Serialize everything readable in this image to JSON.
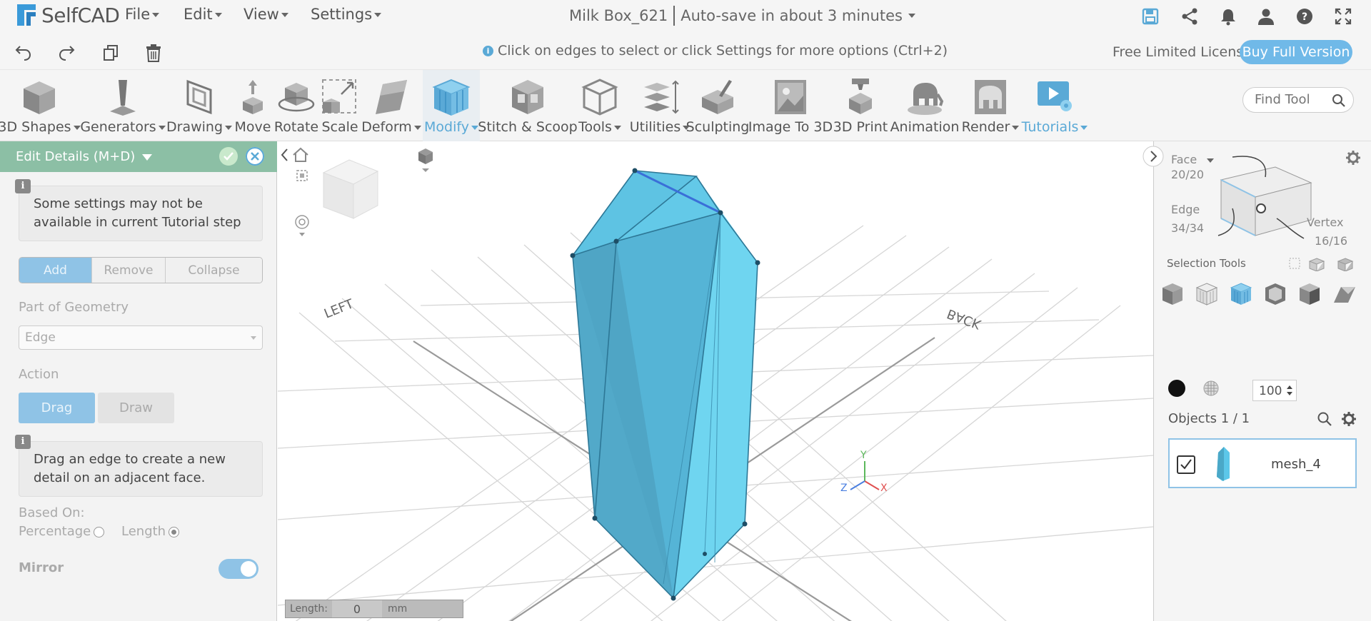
{
  "app": {
    "name": "SelfCAD"
  },
  "menu": {
    "file": "File",
    "edit": "Edit",
    "view": "View",
    "settings": "Settings"
  },
  "header": {
    "project_name": "Milk Box_621",
    "autosave": "Auto-save in about 3 minutes"
  },
  "secondary": {
    "hint": "Click on edges to select or click Settings for more options (Ctrl+2)",
    "license": "Free Limited License",
    "buy_label": "Buy Full Version"
  },
  "toolbar": {
    "tools": [
      {
        "label": "3D Shapes",
        "dropdown": true
      },
      {
        "label": "Generators",
        "dropdown": true
      },
      {
        "label": "Drawing",
        "dropdown": true
      },
      {
        "label": "Move"
      },
      {
        "label": "Rotate"
      },
      {
        "label": "Scale"
      },
      {
        "label": "Deform",
        "dropdown": true
      },
      {
        "label": "Modify",
        "dropdown": true,
        "active": true
      },
      {
        "label": "Stitch & Scoop"
      },
      {
        "label": "Tools",
        "dropdown": true
      },
      {
        "label": "Utilities",
        "dropdown": true
      },
      {
        "label": "Sculpting"
      },
      {
        "label": "Image To 3D"
      },
      {
        "label": "3D Print"
      },
      {
        "label": "Animation"
      },
      {
        "label": "Render",
        "dropdown": true
      },
      {
        "label": "Tutorials",
        "dropdown": true
      }
    ],
    "find_placeholder": "Find Tool"
  },
  "left_panel": {
    "title": "Edit Details (M+D)",
    "note1": "Some settings may not be available in current Tutorial step",
    "modes": [
      "Add",
      "Remove",
      "Collapse"
    ],
    "part_of_geometry_label": "Part of Geometry",
    "part_of_geometry_value": "Edge",
    "action_label": "Action",
    "action_drag": "Drag",
    "action_draw": "Draw",
    "note2": "Drag an edge to create a new detail on an adjacent face.",
    "based_on_label": "Based On:",
    "percentage_label": "Percentage",
    "length_label": "Length",
    "based_on_selected": "Length",
    "mirror_label": "Mirror",
    "mirror_on": true
  },
  "viewport": {
    "left_label": "LEFT",
    "back_label": "BACK",
    "length_label": "Length:",
    "length_value": "0",
    "length_unit": "mm",
    "axes": {
      "x": "X",
      "y": "Y",
      "z": "Z"
    }
  },
  "right_panel": {
    "face_label": "Face",
    "face_count": "20/20",
    "edge_label": "Edge",
    "edge_count": "34/34",
    "vertex_label": "Vertex",
    "vertex_count": "16/16",
    "selection_tools_label": "Selection Tools",
    "opacity_value": "100",
    "objects_label": "Objects 1 / 1",
    "object_name": "mesh_4"
  },
  "colors": {
    "accent": "#5aa9d6",
    "mesh": "#5cc7e9",
    "panel_header": "#8cbfa5"
  }
}
